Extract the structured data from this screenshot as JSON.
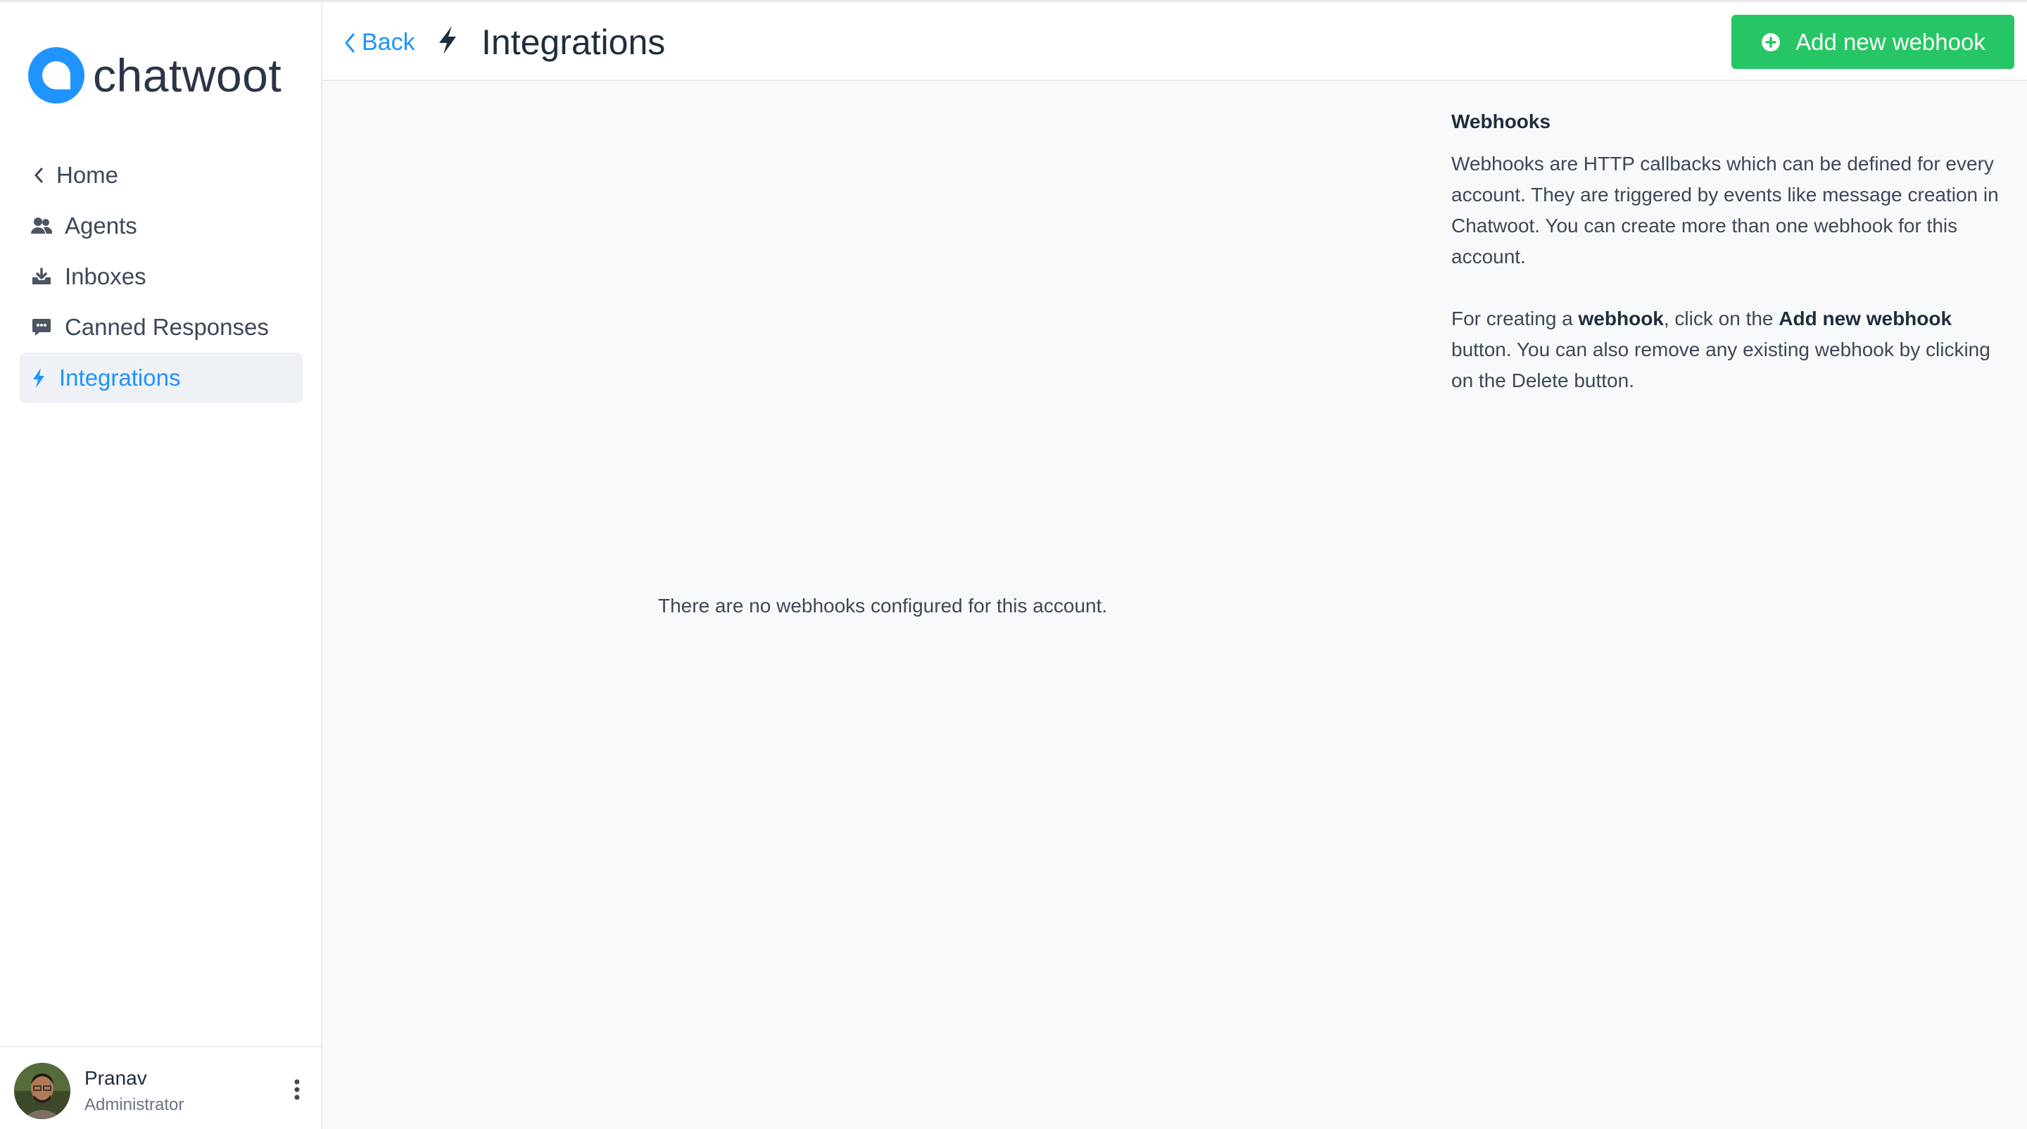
{
  "brand": {
    "name": "chatwoot",
    "color": "#1f93ff"
  },
  "sidebar": {
    "items": [
      {
        "label": "Home",
        "icon": "chevron-left-icon"
      },
      {
        "label": "Agents",
        "icon": "people-icon"
      },
      {
        "label": "Inboxes",
        "icon": "inbox-icon"
      },
      {
        "label": "Canned Responses",
        "icon": "chat-bubble-icon"
      },
      {
        "label": "Integrations",
        "icon": "lightning-icon",
        "active": true
      }
    ]
  },
  "profile": {
    "name": "Pranav",
    "role": "Administrator"
  },
  "header": {
    "back_label": "Back",
    "title": "Integrations",
    "add_button_label": "Add new webhook"
  },
  "main": {
    "empty_message": "There are no webhooks configured for this account."
  },
  "help": {
    "title": "Webhooks",
    "paragraph1": "Webhooks are HTTP callbacks which can be defined for every account. They are triggered by events like message creation in Chatwoot. You can create more than one webhook for this account.",
    "p2_prefix": "For creating a ",
    "p2_bold1": "webhook",
    "p2_middle": ", click on the ",
    "p2_bold2": "Add new webhook",
    "p2_suffix": " button. You can also remove any existing webhook by clicking on the Delete button."
  },
  "colors": {
    "accent": "#1f93ff",
    "success": "#26c565",
    "text": "#3c4858"
  }
}
